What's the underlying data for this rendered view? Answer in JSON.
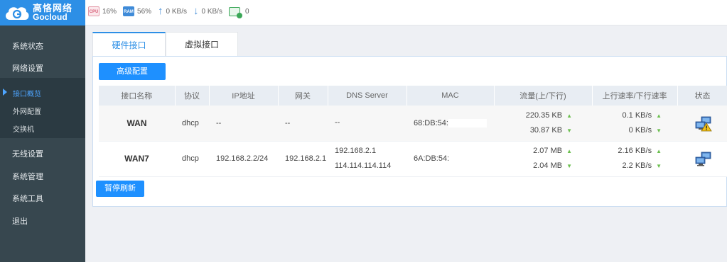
{
  "brand": {
    "name_cn": "高恪网络",
    "name_en": "Gocloud"
  },
  "status_bar": {
    "cpu_label": "CPU",
    "cpu": "16%",
    "ram_label": "RAM",
    "ram": "56%",
    "upload": "0 KB/s",
    "download": "0 KB/s",
    "online": "0",
    "colors": {
      "accent": "#2d8fe6",
      "cpu": "#d9637b",
      "ram": "#3f8bd8",
      "ok": "#3aa757"
    }
  },
  "sidebar": {
    "items": [
      {
        "label": "系统状态"
      },
      {
        "label": "网络设置"
      },
      {
        "label": "无线设置"
      },
      {
        "label": "系统管理"
      },
      {
        "label": "系统工具"
      },
      {
        "label": "退出"
      }
    ],
    "sub_items": [
      {
        "label": "接口概览",
        "active": true
      },
      {
        "label": "外网配置"
      },
      {
        "label": "交换机"
      }
    ]
  },
  "tabs": [
    {
      "label": "硬件接口",
      "active": true
    },
    {
      "label": "虚拟接口"
    }
  ],
  "buttons": {
    "advanced": "高级配置",
    "pause_refresh": "暂停刷新"
  },
  "table": {
    "headers": [
      "接口名称",
      "协议",
      "IP地址",
      "网关",
      "DNS Server",
      "MAC",
      "流量(上/下行)",
      "上行速率/下行速率",
      "状态"
    ],
    "rows": [
      {
        "name": "WAN",
        "protocol": "dhcp",
        "ip": "--",
        "gateway": "--",
        "dns": [
          "--"
        ],
        "mac": "68:DB:54:",
        "traffic_up": "220.35 KB",
        "traffic_down": "30.87 KB",
        "rate_up": "0.1 KB/s",
        "rate_down": "0 KB/s",
        "status_icon": "network-warning-icon"
      },
      {
        "name": "WAN7",
        "protocol": "dhcp",
        "ip": "192.168.2.2/24",
        "gateway": "192.168.2.1",
        "dns": [
          "192.168.2.1",
          "114.114.114.114"
        ],
        "mac": "6A:DB:54:",
        "traffic_up": "2.07 MB",
        "traffic_down": "2.04 MB",
        "rate_up": "2.16 KB/s",
        "rate_down": "2.2 KB/s",
        "status_icon": "network-connected-icon"
      }
    ]
  }
}
